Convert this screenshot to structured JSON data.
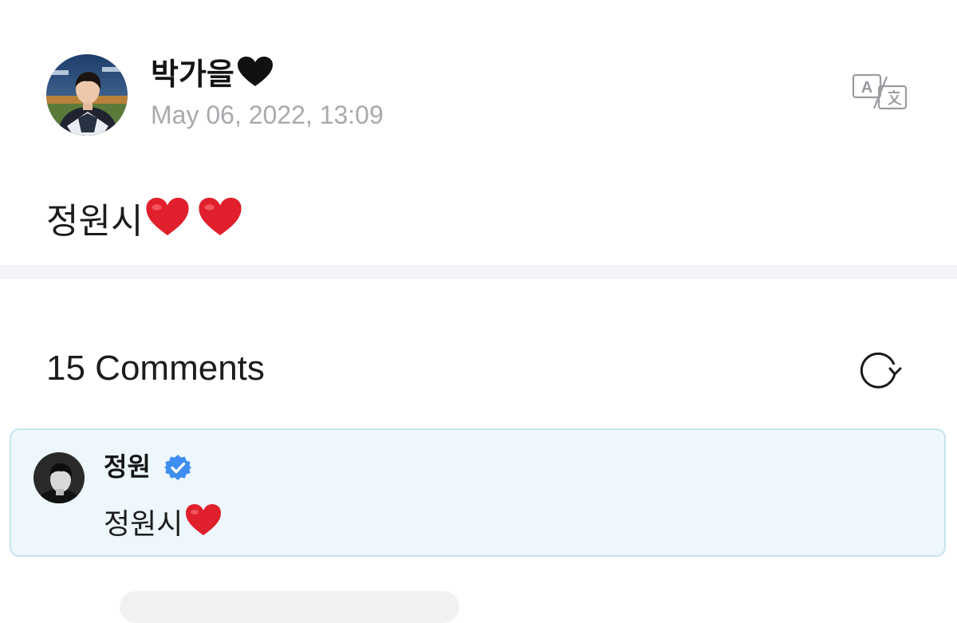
{
  "post": {
    "author_name": "박가을",
    "author_emoji": "🖤",
    "timestamp": "May 06, 2022, 13:09",
    "body_text": "정원시",
    "body_emoji_count": 2,
    "translate_icon": "translate-icon"
  },
  "comments": {
    "title": "15 Comments",
    "refresh_icon": "refresh-icon",
    "items": [
      {
        "author": "정원",
        "verified": true,
        "text": "정원시",
        "emoji_count": 1
      }
    ]
  },
  "colors": {
    "date_gray": "#a9a9ae",
    "highlight_bg": "#edf7fc",
    "highlight_border": "#c6e3ee",
    "verified_blue": "#3d8ef0",
    "heart_red": "#e0202c"
  }
}
